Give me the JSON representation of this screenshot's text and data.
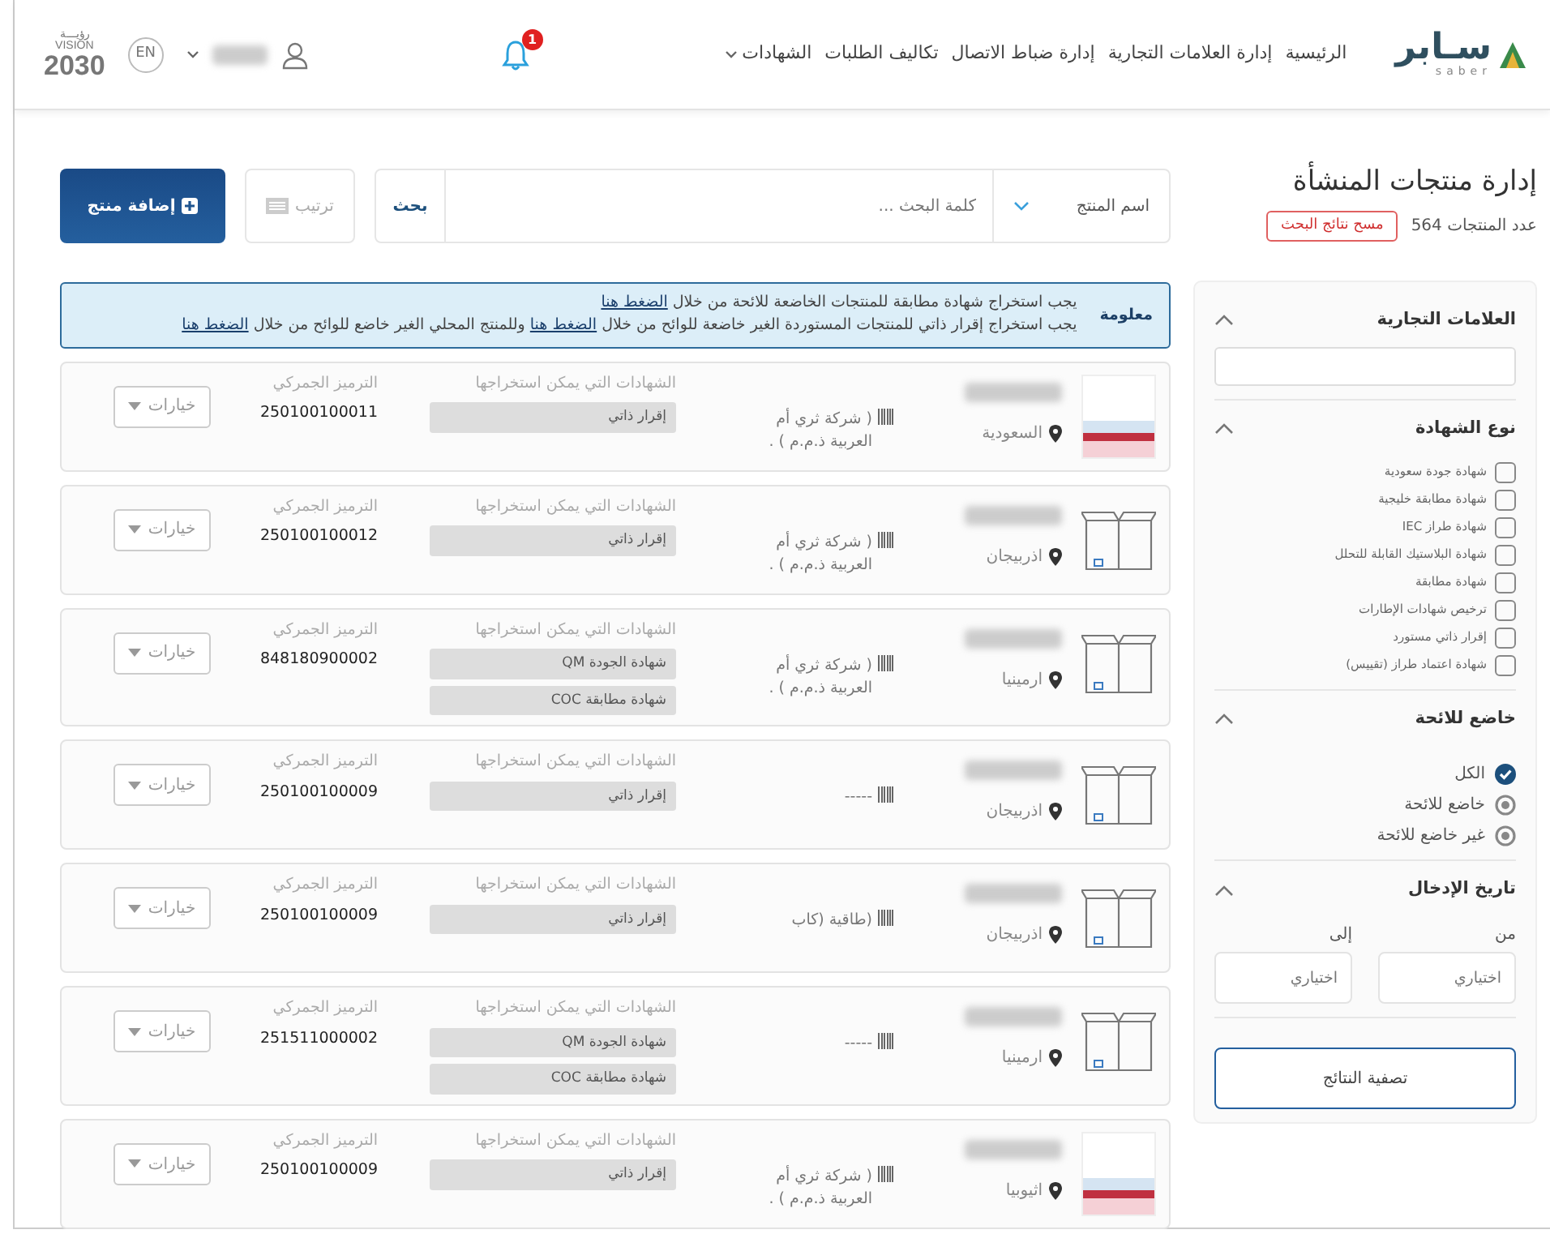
{
  "header": {
    "logo": {
      "text": "سـابر",
      "subtext": "saber"
    },
    "nav": [
      {
        "label": "الرئيسية",
        "dropdown": false
      },
      {
        "label": "إدارة العلامات التجارية",
        "dropdown": false
      },
      {
        "label": "إدارة ضباط الاتصال",
        "dropdown": false
      },
      {
        "label": "تكاليف الطلبات",
        "dropdown": false
      },
      {
        "label": "الشهادات",
        "dropdown": true
      }
    ],
    "notifications": {
      "count": "1"
    },
    "language": "EN",
    "vision": {
      "arabic": "رؤيـــة",
      "latin": "VISION",
      "year": "2030"
    }
  },
  "page": {
    "title": "إدارة منتجات المنشأة",
    "count": "عدد المنتجات 564",
    "clear_button": "مسح نتائج البحث"
  },
  "search": {
    "field_select": "اسم المنتج",
    "placeholder": "كلمة البحث ...",
    "button": "بحث",
    "sort_button": "ترتيب",
    "add_button": "إضافة منتج"
  },
  "info": {
    "label": "معلومة",
    "lines": [
      [
        {
          "text": "يجب استخراج شهادة مطابقة للمنتجات الخاضعة للائحة من خلال "
        },
        {
          "link": "الضغط هنا"
        }
      ],
      [
        {
          "text": "يجب استخراج إقرار ذاتي للمنتجات المستوردة الغير خاضعة للوائح من خلال "
        },
        {
          "link": "الضغط هنا"
        },
        {
          "text": " وللمنتج المحلي الغير خاضع للوائح من خلال "
        },
        {
          "link": "الضغط هنا"
        }
      ]
    ]
  },
  "filters": {
    "sections": [
      {
        "kind": "text",
        "title": "العلامات التجارية",
        "expanded": true
      },
      {
        "kind": "checkboxes",
        "title": "نوع الشهادة",
        "expanded": true,
        "options": [
          {
            "label": "شهادة جودة سعودية",
            "checked": false
          },
          {
            "label": "شهادة مطابقة خليجية",
            "checked": false
          },
          {
            "label": "شهادة طراز IEC",
            "checked": false
          },
          {
            "label": "شهادة البلاستيك القابلة للتحلل",
            "checked": false
          },
          {
            "label": "شهادة مطابقة",
            "checked": false
          },
          {
            "label": "ترخيص شهادات الإطارات",
            "checked": false
          },
          {
            "label": "إقرار ذاتي مستورد",
            "checked": false
          },
          {
            "label": "شهادة اعتماد طراز (تقييس)",
            "checked": false
          }
        ]
      },
      {
        "kind": "radios",
        "title": "خاضع للائحة",
        "expanded": true,
        "options": [
          {
            "label": "الكل",
            "selected": true
          },
          {
            "label": "خاضع للائحة",
            "selected": false
          },
          {
            "label": "غير خاضع للائحة",
            "selected": false
          }
        ]
      },
      {
        "kind": "dates",
        "title": "تاريخ الإدخال",
        "expanded": true,
        "from_label": "من",
        "to_label": "إلى",
        "from_placeholder": "اختياري",
        "to_placeholder": "اختياري"
      }
    ],
    "apply_button": "تصفية النتائج"
  },
  "products": [
    {
      "kind": "thumbnail",
      "country": "السعودية",
      "company": "( شركة ثري أم العربية ذ.م.م ) .",
      "certs_header": "الشهادات التي يمكن استخراجها",
      "certs": [
        "إقرار ذاتي"
      ],
      "tariff_label": "الترميز الجمركي",
      "tariff": "250100100011",
      "options": "خيارات"
    },
    {
      "kind": "box",
      "country": "اذربيجان",
      "company": "( شركة ثري أم العربية ذ.م.م ) .",
      "certs_header": "الشهادات التي يمكن استخراجها",
      "certs": [
        "إقرار ذاتي"
      ],
      "tariff_label": "الترميز الجمركي",
      "tariff": "250100100012",
      "options": "خيارات"
    },
    {
      "kind": "box",
      "country": "ارمينيا",
      "company": "( شركة ثري أم العربية ذ.م.م ) .",
      "certs_header": "الشهادات التي يمكن استخراجها",
      "certs": [
        "شهادة الجودة QM",
        "شهادة مطابقة COC"
      ],
      "tariff_label": "الترميز الجمركي",
      "tariff": "848180900002",
      "options": "خيارات"
    },
    {
      "kind": "box",
      "country": "اذربيجان",
      "company": "-----",
      "certs_header": "الشهادات التي يمكن استخراجها",
      "certs": [
        "إقرار ذاتي"
      ],
      "tariff_label": "الترميز الجمركي",
      "tariff": "250100100009",
      "options": "خيارات"
    },
    {
      "kind": "box",
      "country": "اذربيجان",
      "company": "(طاقية (كاب",
      "certs_header": "الشهادات التي يمكن استخراجها",
      "certs": [
        "إقرار ذاتي"
      ],
      "tariff_label": "الترميز الجمركي",
      "tariff": "250100100009",
      "options": "خيارات"
    },
    {
      "kind": "box",
      "country": "ارمينيا",
      "company": "-----",
      "certs_header": "الشهادات التي يمكن استخراجها",
      "certs": [
        "شهادة الجودة QM",
        "شهادة مطابقة COC"
      ],
      "tariff_label": "الترميز الجمركي",
      "tariff": "251511000002",
      "options": "خيارات"
    },
    {
      "kind": "thumbnail",
      "country": "اثيوبيا",
      "company": "( شركة ثري أم العربية ذ.م.م ) .",
      "certs_header": "الشهادات التي يمكن استخراجها",
      "certs": [
        "إقرار ذاتي"
      ],
      "tariff_label": "الترميز الجمركي",
      "tariff": "250100100009",
      "options": "خيارات"
    }
  ]
}
